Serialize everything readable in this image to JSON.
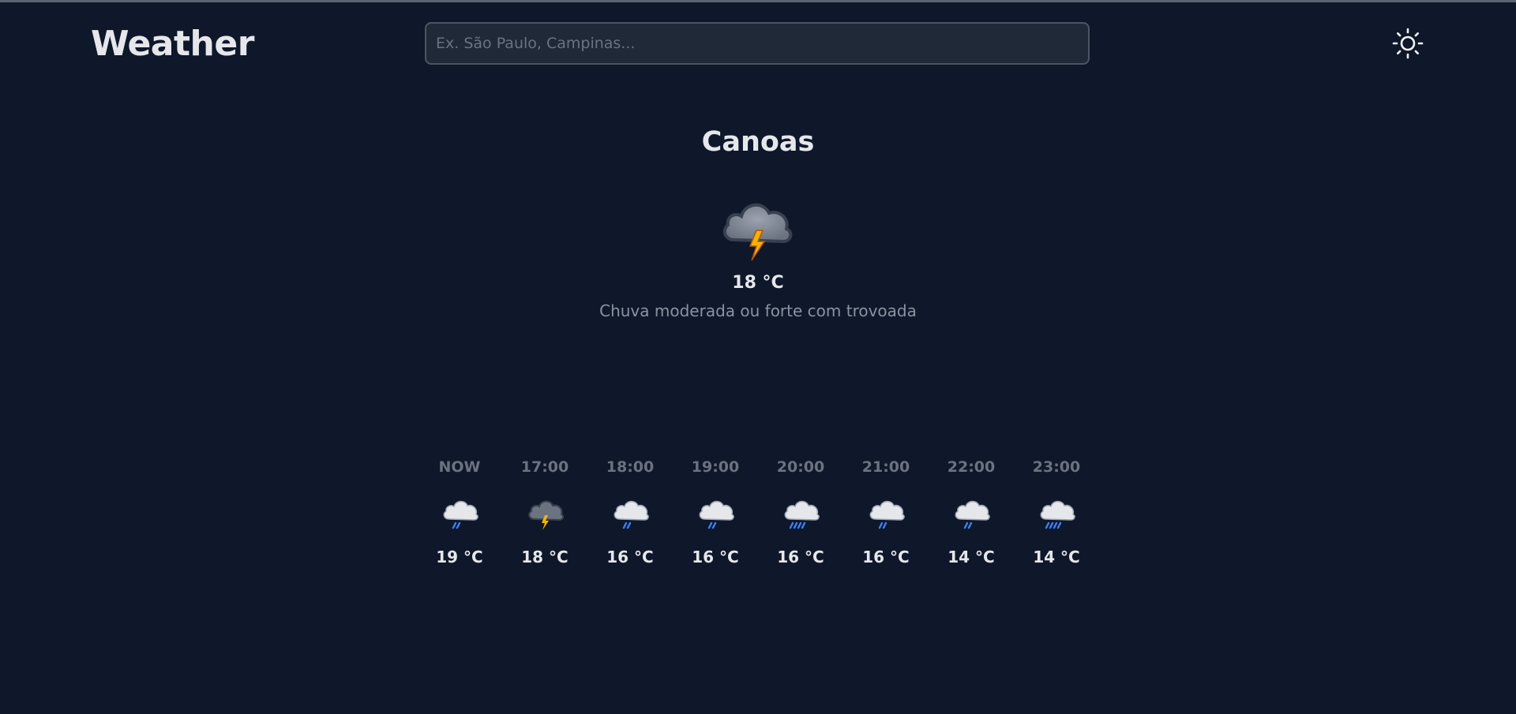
{
  "app": {
    "title": "Weather"
  },
  "search": {
    "placeholder": "Ex. São Paulo, Campinas..."
  },
  "current": {
    "city": "Canoas",
    "icon": "storm-cloud-lightning-icon",
    "temp": "18 °C",
    "description": "Chuva moderada ou forte com trovoada"
  },
  "forecast": [
    {
      "time": "NOW",
      "temp": "19 °C",
      "icon": "cloud-light-rain-icon"
    },
    {
      "time": "17:00",
      "temp": "18 °C",
      "icon": "storm-cloud-lightning-icon"
    },
    {
      "time": "18:00",
      "temp": "16 °C",
      "icon": "cloud-light-rain-icon"
    },
    {
      "time": "19:00",
      "temp": "16 °C",
      "icon": "cloud-light-rain-icon"
    },
    {
      "time": "20:00",
      "temp": "16 °C",
      "icon": "cloud-heavy-rain-icon"
    },
    {
      "time": "21:00",
      "temp": "16 °C",
      "icon": "cloud-light-rain-icon"
    },
    {
      "time": "22:00",
      "temp": "14 °C",
      "icon": "cloud-light-rain-icon"
    },
    {
      "time": "23:00",
      "temp": "14 °C",
      "icon": "cloud-heavy-rain-icon"
    }
  ],
  "colors": {
    "background": "#0f172a",
    "text": "#e5e7eb",
    "muted": "#6b7280",
    "rain": "#3b82f6",
    "lightning": "#f5b301"
  }
}
